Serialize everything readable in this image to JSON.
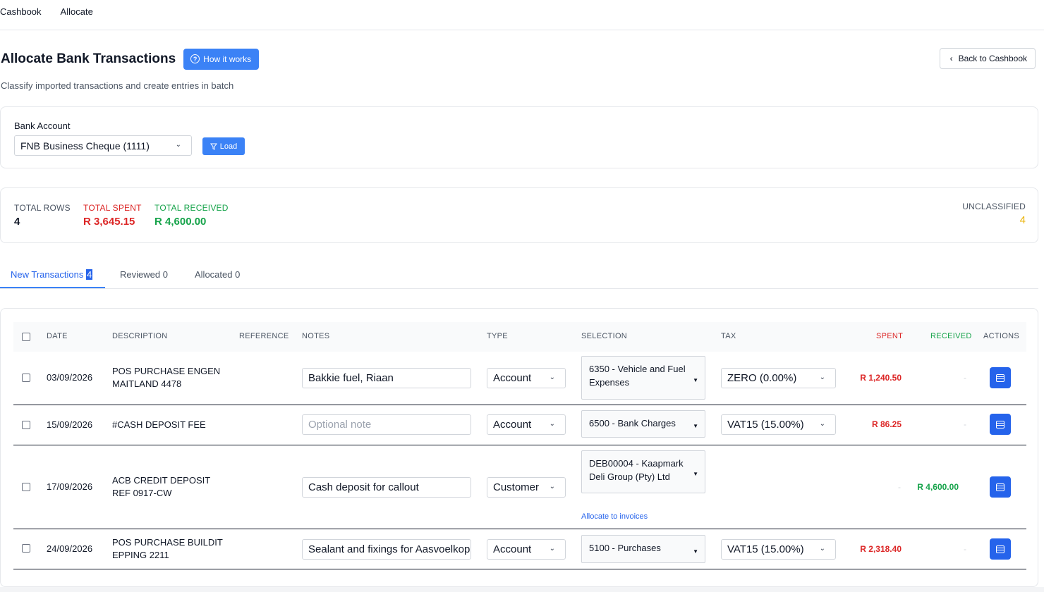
{
  "topnav": {
    "cashbook": "Cashbook",
    "allocate": "Allocate"
  },
  "header": {
    "title": "Allocate Bank Transactions",
    "how_label": "How it works",
    "back_label": "Back to Cashbook",
    "subtitle": "Classify imported transactions and create entries in batch"
  },
  "bank": {
    "label": "Bank Account",
    "selected": "FNB Business Cheque (1111)",
    "load_label": "Load"
  },
  "stats": {
    "total_rows_label": "TOTAL ROWS",
    "total_rows": "4",
    "total_spent_label": "TOTAL SPENT",
    "total_spent": "R 3,645.15",
    "total_received_label": "TOTAL RECEIVED",
    "total_received": "R 4,600.00",
    "unclassified_label": "UNCLASSIFIED",
    "unclassified": "4"
  },
  "tabs": {
    "new_label": "New Transactions",
    "new_count": "4",
    "reviewed_label": "Reviewed",
    "reviewed_count": "0",
    "allocated_label": "Allocated",
    "allocated_count": "0"
  },
  "table": {
    "headers": [
      "DATE",
      "DESCRIPTION",
      "REFERENCE",
      "NOTES",
      "TYPE",
      "SELECTION",
      "TAX",
      "SPENT",
      "RECEIVED",
      "ACTIONS"
    ],
    "rows": [
      {
        "date": "03/09/2026",
        "desc1": "POS PURCHASE ENGEN",
        "desc2": "MAITLAND 4478",
        "note": "Bakkie fuel, Riaan",
        "type": "Account",
        "sel1": "6350 - Vehicle and Fuel",
        "sel2": "Expenses",
        "tax": "ZERO (0.00%)",
        "spent": "R 1,240.50",
        "received": "-"
      },
      {
        "date": "15/09/2026",
        "desc1": "#CASH DEPOSIT FEE",
        "desc2": "",
        "note_placeholder": "Optional note",
        "type": "Account",
        "sel1": "6500 - Bank Charges",
        "sel2": "",
        "tax": "VAT15 (15.00%)",
        "spent": "R 86.25",
        "received": "-"
      },
      {
        "date": "17/09/2026",
        "desc1": "ACB CREDIT DEPOSIT",
        "desc2": "REF 0917-CW",
        "note": "Cash deposit for callout",
        "type": "Customer",
        "sel1": "DEB00004 - Kaapmark",
        "sel2": "Deli Group (Pty) Ltd",
        "link": "Allocate to invoices",
        "spent": "-",
        "received": "R 4,600.00"
      },
      {
        "date": "24/09/2026",
        "desc1": "POS PURCHASE BUILDIT",
        "desc2": "EPPING 2211",
        "note": "Sealant and fixings for Aasvoelkop job",
        "type": "Account",
        "sel1": "5100 - Purchases",
        "sel2": "",
        "tax": "VAT15 (15.00%)",
        "spent": "R 2,318.40",
        "received": "-"
      }
    ]
  },
  "colors": {
    "accent": "#3b82f6",
    "spent": "#dc2626",
    "received": "#16a34a",
    "unclassified": "#eab308"
  }
}
